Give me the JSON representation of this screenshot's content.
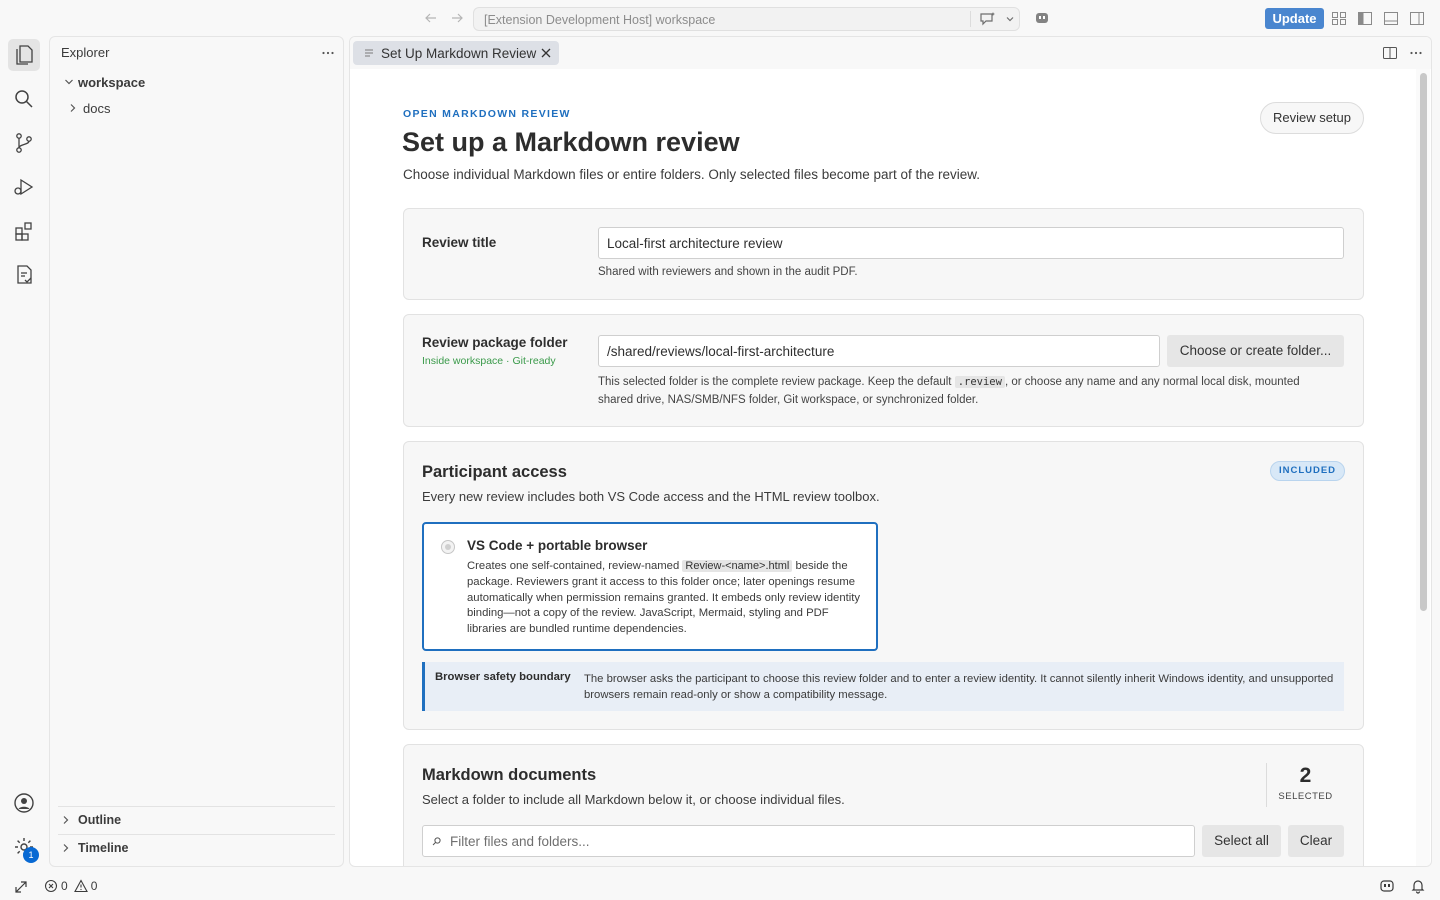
{
  "titlebar": {
    "command_center_text": "[Extension Development Host] workspace",
    "update_label": "Update"
  },
  "activity_bar": {
    "items": [
      "explorer-icon",
      "search-icon",
      "source-control-icon",
      "run-debug-icon",
      "extensions-icon",
      "markdown-review-icon"
    ],
    "accounts_icon": "account-icon",
    "settings_badge": "1"
  },
  "sidebar": {
    "title": "Explorer",
    "tree": {
      "root": "workspace",
      "children": [
        "docs"
      ]
    },
    "sections": [
      "Outline",
      "Timeline"
    ]
  },
  "editor": {
    "tab_label": "Set Up Markdown Review"
  },
  "review": {
    "eyebrow": "OPEN MARKDOWN REVIEW",
    "title": "Set up a Markdown review",
    "subtitle": "Choose individual Markdown files or entire folders. Only selected files become part of the review.",
    "setup_button": "Review setup",
    "review_title": {
      "label": "Review title",
      "value": "Local-first architecture review",
      "hint": "Shared with reviewers and shown in the audit PDF."
    },
    "package_folder": {
      "label": "Review package folder",
      "status": "Inside workspace · Git-ready",
      "value": "/shared/reviews/local-first-architecture",
      "button": "Choose or create folder...",
      "hint_prefix": "This selected folder is the complete review package. Keep the default ",
      "hint_code": ".review",
      "hint_line1_suffix": ", or choose any name and any normal local disk, mounted",
      "hint_line2": "shared drive, NAS/SMB/NFS folder, Git workspace, or synchronized folder."
    },
    "participant_access": {
      "title": "Participant access",
      "badge": "INCLUDED",
      "subtitle": "Every new review includes both VS Code access and the HTML review toolbox.",
      "option": {
        "title": "VS Code + portable browser",
        "desc_prefix": "Creates one self-contained, review-named ",
        "desc_code": "Review-<name>.html",
        "desc_suffix": " beside the package. Reviewers grant it access to this folder once; later openings resume automatically when permission remains granted. It embeds only review identity binding—not a copy of the review. JavaScript, Mermaid, styling and PDF libraries are bundled runtime dependencies."
      },
      "safety_label": "Browser safety boundary",
      "safety_text": "The browser asks the participant to choose this review folder and to enter a review identity. It cannot silently inherit Windows identity, and unsupported browsers remain read-only or show a compatibility message."
    },
    "documents": {
      "title": "Markdown documents",
      "subtitle": "Select a folder to include all Markdown below it, or choose individual files.",
      "selected_count": "2",
      "selected_label": "SELECTED",
      "filter_placeholder": "Filter files and folders...",
      "select_all": "Select all",
      "clear": "Clear"
    }
  },
  "statusbar": {
    "errors": "0",
    "warnings": "0"
  }
}
